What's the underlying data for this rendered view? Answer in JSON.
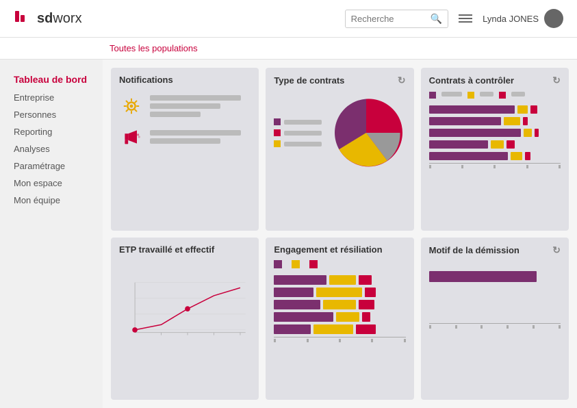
{
  "header": {
    "logo_text": "sdworx",
    "search_placeholder": "Recherche",
    "user_name": "Lynda JONES",
    "population_label": "Toutes les populations"
  },
  "sidebar": {
    "items": [
      {
        "id": "tableau-de-bord",
        "label": "Tableau de bord",
        "active": true
      },
      {
        "id": "entreprise",
        "label": "Entreprise",
        "active": false
      },
      {
        "id": "personnes",
        "label": "Personnes",
        "active": false
      },
      {
        "id": "reporting",
        "label": "Reporting",
        "active": false
      },
      {
        "id": "analyses",
        "label": "Analyses",
        "active": false
      },
      {
        "id": "parametrage",
        "label": "Paramétrage",
        "active": false
      },
      {
        "id": "mon-espace",
        "label": "Mon espace",
        "active": false
      },
      {
        "id": "mon-equipe",
        "label": "Mon équipe",
        "active": false
      }
    ]
  },
  "cards": {
    "notifications": {
      "title": "Notifications"
    },
    "type_contrats": {
      "title": "Type de contrats"
    },
    "contrats_controler": {
      "title": "Contrats à contrôler"
    },
    "etp": {
      "title": "ETP travaillé et effectif"
    },
    "engagement": {
      "title": "Engagement et résiliation"
    },
    "motif": {
      "title": "Motif de la démission"
    }
  }
}
